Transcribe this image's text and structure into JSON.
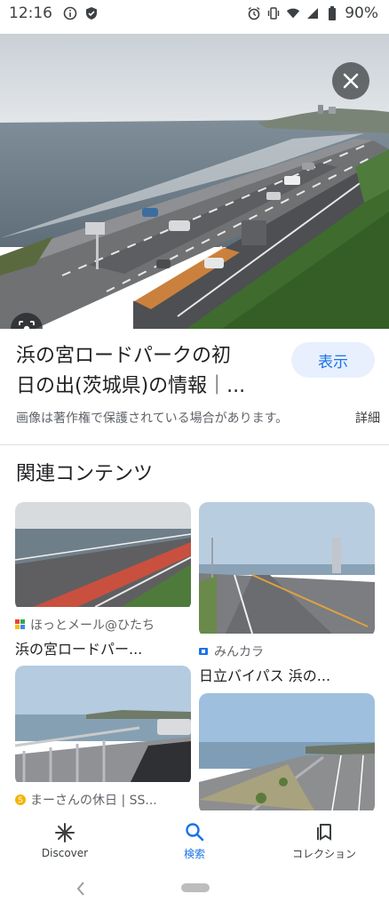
{
  "status_bar": {
    "time": "12:16",
    "battery": "90%",
    "icons": [
      "info-icon",
      "shield-icon",
      "alarm-icon",
      "vibrate-icon",
      "wifi-icon",
      "signal-icon",
      "battery-icon"
    ]
  },
  "hero": {
    "close_icon": "close-icon",
    "lens_icon": "lens-icon"
  },
  "result": {
    "title_line1": "浜の宮ロードパークの初",
    "title_line2": "日の出(茨城県)の情報｜...",
    "show_button": "表示",
    "copyright_note": "画像は著作権で保護されている場合があります。",
    "details_link": "詳細"
  },
  "related": {
    "heading": "関連コンテンツ",
    "cards": [
      {
        "source": "ほっとメール@ひたち",
        "title": "浜の宮ロードパー..."
      },
      {
        "source": "みんカラ",
        "title": "日立バイパス 浜の..."
      },
      {
        "source": "まーさんの休日 | SS...",
        "title": ""
      },
      {
        "source": "",
        "title": ""
      }
    ]
  },
  "bottom_nav": {
    "items": [
      {
        "label": "Discover",
        "icon": "asterisk-icon"
      },
      {
        "label": "検索",
        "icon": "search-icon"
      },
      {
        "label": "コレクション",
        "icon": "collections-icon"
      }
    ],
    "active_index": 1
  },
  "colors": {
    "accent": "#1a73e8",
    "accent_bg": "#e8f0fe",
    "text_primary": "#202124",
    "text_secondary": "#5f6368"
  }
}
